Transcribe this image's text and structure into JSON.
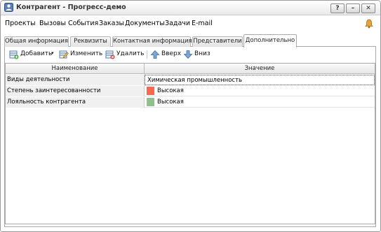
{
  "window": {
    "title": "Контрагент - Прогресс-демо",
    "buttons": {
      "help": "?",
      "minimize": "–",
      "close": "✕"
    }
  },
  "menu": {
    "items": [
      "Проекты",
      "Вызовы",
      "События",
      "Заказы",
      "Документы",
      "Задачи",
      "E-mail"
    ]
  },
  "tabs": [
    {
      "label": "Общая информация",
      "active": false
    },
    {
      "label": "Реквизиты",
      "active": false
    },
    {
      "label": "Контактная информация",
      "active": false
    },
    {
      "label": "Представители",
      "active": false
    },
    {
      "label": "Дополнительно",
      "active": true
    }
  ],
  "toolbar": {
    "add_label": "Добавить",
    "edit_label": "Изменить",
    "delete_label": "Удалить",
    "up_label": "Вверх",
    "down_label": "Вниз"
  },
  "grid": {
    "columns": [
      "Наименование",
      "Значение"
    ],
    "rows": [
      {
        "name": "Виды деятельности",
        "value": "Химическая промышленность",
        "swatch": null
      },
      {
        "name": "Степень заинтересованности",
        "value": "Высокая",
        "swatch": "#f26a4f"
      },
      {
        "name": "Лояльность контрагента",
        "value": "Высокая",
        "swatch": "#8fc18f"
      }
    ]
  },
  "colors": {
    "accent_orange": "#f26a4f",
    "accent_green": "#8fc18f",
    "bell": "#e8a33a"
  }
}
